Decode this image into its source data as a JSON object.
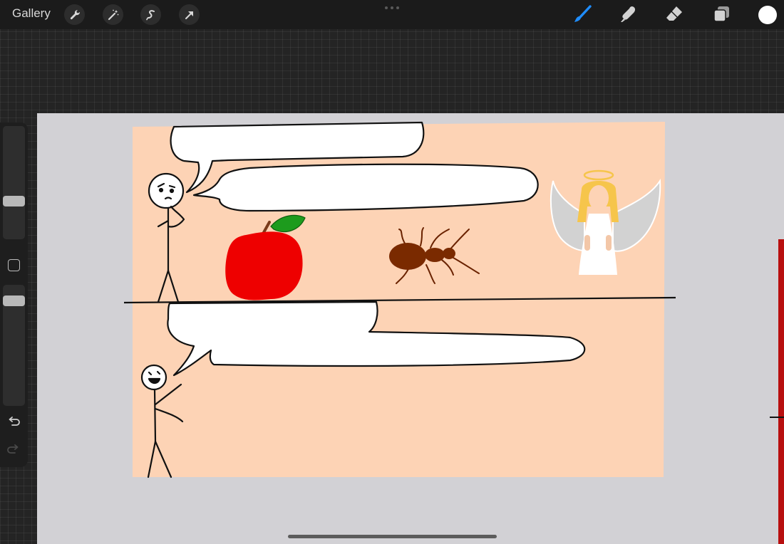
{
  "topbar": {
    "gallery_label": "Gallery",
    "left_tools": [
      {
        "icon": "wrench-icon",
        "name": "actions-button"
      },
      {
        "icon": "magic-wand-icon",
        "name": "adjustments-button"
      },
      {
        "icon": "selection-icon",
        "name": "selection-button"
      },
      {
        "icon": "transform-arrow-icon",
        "name": "transform-button"
      }
    ],
    "right_tools": [
      {
        "icon": "brush-icon",
        "name": "brush-button",
        "active": true
      },
      {
        "icon": "smudge-icon",
        "name": "smudge-button"
      },
      {
        "icon": "eraser-icon",
        "name": "eraser-button"
      },
      {
        "icon": "layers-icon",
        "name": "layers-button"
      }
    ],
    "current_color": "#ffffff"
  },
  "sidebar": {
    "brush_size_level": 0.32,
    "opacity_level": 0.9,
    "icons": [
      "undo-icon",
      "redo-icon"
    ]
  },
  "colors": {
    "accent": "#1f8dff",
    "canvas_background": "#fdd3b5",
    "apple": "#ee0000",
    "leaf": "#1d9b1d",
    "ant": "#7a2a00",
    "halo_hair": "#f6c54b",
    "wings": "#d2d2d2",
    "red_edge": "#b80f0f"
  }
}
